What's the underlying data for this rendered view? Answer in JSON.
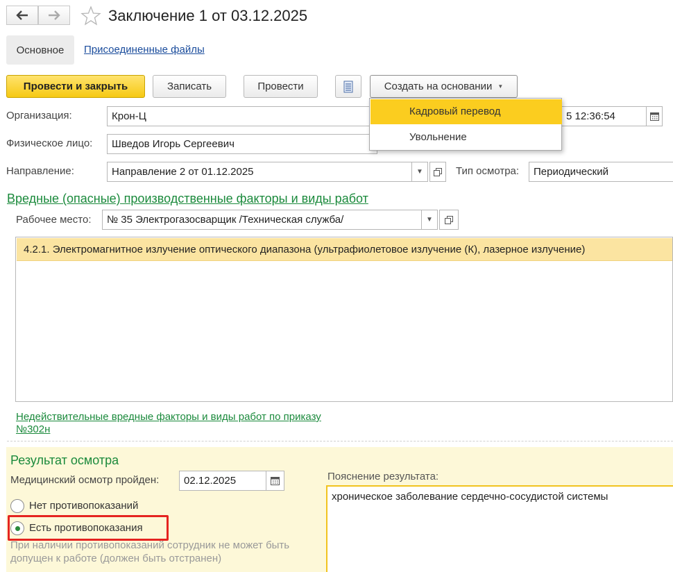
{
  "header": {
    "back_icon": "arrow-left-icon",
    "forward_icon": "arrow-right-icon",
    "favorite_icon": "star-icon",
    "title": "Заключение 1 от 03.12.2025"
  },
  "tabs": {
    "main": "Основное",
    "files": "Присоединенные файлы"
  },
  "toolbar": {
    "post_and_close": "Провести и закрыть",
    "save": "Записать",
    "post": "Провести",
    "report_icon": "report-list-icon",
    "create_based_on": "Создать на основании"
  },
  "create_menu": {
    "items": [
      "Кадровый перевод",
      "Увольнение"
    ],
    "active_index": 0
  },
  "form": {
    "organization_label": "Организация:",
    "organization_value": "Крон-Ц",
    "date_value": "5 12:36:54",
    "person_label": "Физическое лицо:",
    "person_value": "Шведов Игорь Сергеевич",
    "direction_label": "Направление:",
    "direction_value": "Направление 2 от 01.12.2025",
    "exam_type_label": "Тип осмотра:",
    "exam_type_value": "Периодический"
  },
  "factors": {
    "section_title": "Вредные (опасные) производственные факторы и виды работ",
    "workplace_label": "Рабочее место:",
    "workplace_value": "№ 35 Электрогазосварщик /Техническая служба/",
    "rows": [
      "4.2.1. Электромагнитное излучение оптического диапазона (ультрафиолетовое излучение (К), лазерное излучение)"
    ],
    "invalid_link_line1": "Недействительные вредные факторы и виды работ по приказу",
    "invalid_link_line2": "№302н"
  },
  "result": {
    "title": "Результат осмотра",
    "passed_label": "Медицинский осмотр пройден:",
    "passed_date": "02.12.2025",
    "option_none": "Нет противопоказаний",
    "option_has": "Есть противопоказания",
    "selected": "has",
    "note": "При наличии противопоказаний сотрудник не может быть допущен к работе (должен быть отстранен)",
    "explanation_label": "Пояснение результата:",
    "explanation_value": "хроническое заболевание сердечно-сосудистой системы"
  },
  "colors": {
    "primary_button": "#f6c913",
    "section_green": "#1b8a3c",
    "highlight_row": "#fbe4a1",
    "highlight_frame": "#e52420"
  }
}
